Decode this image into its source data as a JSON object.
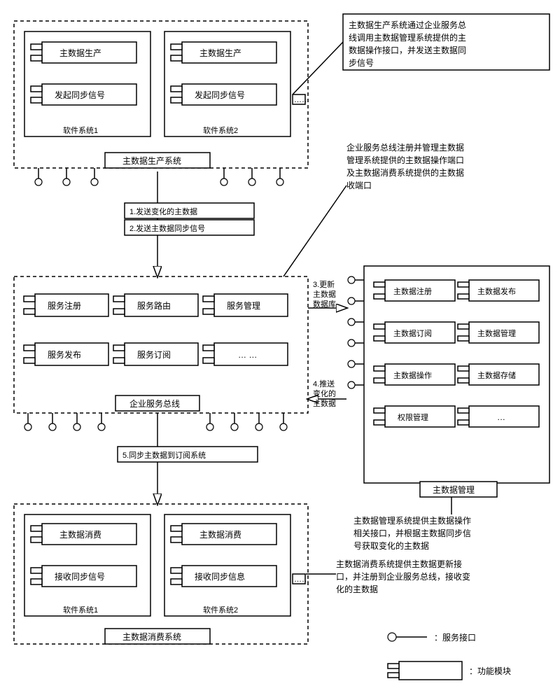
{
  "producer": {
    "title": "主数据生产系统",
    "systems": [
      {
        "label": "软件系统1",
        "modules": [
          "主数据生产",
          "发起同步信号"
        ]
      },
      {
        "label": "软件系统2",
        "modules": [
          "主数据生产",
          "发起同步信号"
        ]
      }
    ]
  },
  "consumer": {
    "title": "主数据消费系统",
    "systems": [
      {
        "label": "软件系统1",
        "modules": [
          "主数据消费",
          "接收同步信号"
        ]
      },
      {
        "label": "软件系统2",
        "modules": [
          "主数据消费",
          "接收同步信息"
        ]
      }
    ]
  },
  "esb": {
    "title": "企业服务总线",
    "modules": [
      "服务注册",
      "服务路由",
      "服务管理",
      "服务发布",
      "服务订阅",
      "… …"
    ]
  },
  "mdm": {
    "title": "主数据管理",
    "modules": [
      "主数据注册",
      "主数据发布",
      "主数据订阅",
      "主数据管理",
      "主数据操作",
      "主数据存储",
      "权限管理",
      "…"
    ]
  },
  "flows": {
    "f1": "1.发送变化的主数据",
    "f2": "2.发送主数据同步信号",
    "f3": [
      "3.更新",
      "主数据",
      "数据库"
    ],
    "f4": [
      "4.推送",
      "变化的",
      "主数据"
    ],
    "f5": "5.同步主数据到订阅系统"
  },
  "notes": {
    "n1": [
      "主数据生产系统通过企业服务总",
      "线调用主数据管理系统提供的主",
      "数据操作接口，并发送主数据同",
      "步信号"
    ],
    "n2": [
      "企业服务总线注册并管理主数据",
      "管理系统提供的主数据操作端口",
      "及主数据消费系统提供的主数据",
      "收端口"
    ],
    "n3": [
      "主数据管理系统提供主数据操作",
      "相关接口，并根据主数据同步信",
      "号获取变化的主数据"
    ],
    "n4": [
      "主数据消费系统提供主数据更新接",
      "口，并注册到企业服务总线，接收变",
      "化的主数据"
    ]
  },
  "legend": {
    "iface": "：服务接口",
    "module": "：功能模块"
  },
  "ellipsis": "……"
}
